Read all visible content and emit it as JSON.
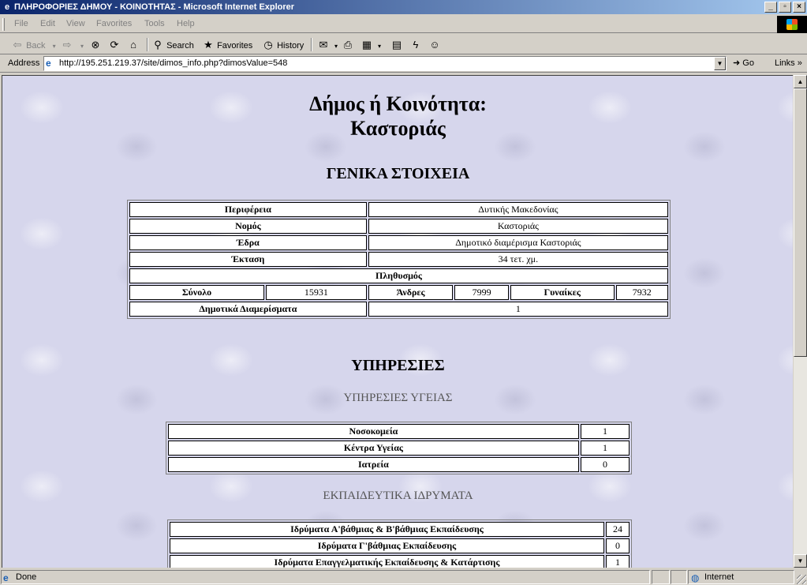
{
  "window": {
    "title": "ΠΛΗΡΟΦΟΡΙΕΣ ΔΗΜΟΥ - ΚΟΙΝΟΤΗΤΑΣ - Microsoft Internet Explorer",
    "icon": "ie-icon",
    "minimize": "_",
    "maximize": "▫",
    "close": "×"
  },
  "menu": [
    "File",
    "Edit",
    "View",
    "Favorites",
    "Tools",
    "Help"
  ],
  "toolbar": {
    "back": "Back",
    "search": "Search",
    "favorites": "Favorites",
    "history": "History"
  },
  "address": {
    "label": "Address",
    "url": "http://195.251.219.37/site/dimos_info.php?dimosValue=548",
    "go": "Go",
    "links": "Links"
  },
  "page": {
    "title_line1": "Δήμος ή Κοινότητα:",
    "title_line2": "Καστοριάς",
    "general_heading": "ΓΕΝΙΚΑ ΣΤΟΙΧΕΙΑ",
    "general": {
      "region_label": "Περιφέρεια",
      "region_value": "Δυτικής Μακεδονίας",
      "prefecture_label": "Νομός",
      "prefecture_value": "Καστοριάς",
      "seat_label": "Έδρα",
      "seat_value": "Δημοτικό διαμέρισμα Καστοριάς",
      "area_label": "Έκταση",
      "area_value": "34 τετ. χμ.",
      "population_label": "Πληθυσμός",
      "total_label": "Σύνολο",
      "total_value": "15931",
      "men_label": "Άνδρες",
      "men_value": "7999",
      "women_label": "Γυναίκες",
      "women_value": "7932",
      "districts_label": "Δημοτικά Διαμερίσματα",
      "districts_value": "1"
    },
    "services_heading": "ΥΠΗΡΕΣΙΕΣ",
    "health_heading": "ΥΠΗΡΕΣΙΕΣ ΥΓΕΙΑΣ",
    "health": [
      {
        "label": "Νοσοκομεία",
        "value": "1"
      },
      {
        "label": "Κέντρα Υγείας",
        "value": "1"
      },
      {
        "label": "Ιατρεία",
        "value": "0"
      }
    ],
    "education_heading": "ΕΚΠΑΙΔΕΥΤΙΚΑ ΙΔΡΥΜΑΤΑ",
    "education": [
      {
        "label": "Ιδρύματα Α'βάθμιας & Β'βάθμιας Εκπαίδευσης",
        "value": "24"
      },
      {
        "label": "Ιδρύματα Γ'βάθμιας Εκπαίδευσης",
        "value": "0"
      },
      {
        "label": "Ιδρύματα Επαγγελματικής Εκπαίδευσης & Κατάρτισης",
        "value": "1"
      }
    ]
  },
  "status": {
    "text": "Done",
    "zone": "Internet"
  }
}
